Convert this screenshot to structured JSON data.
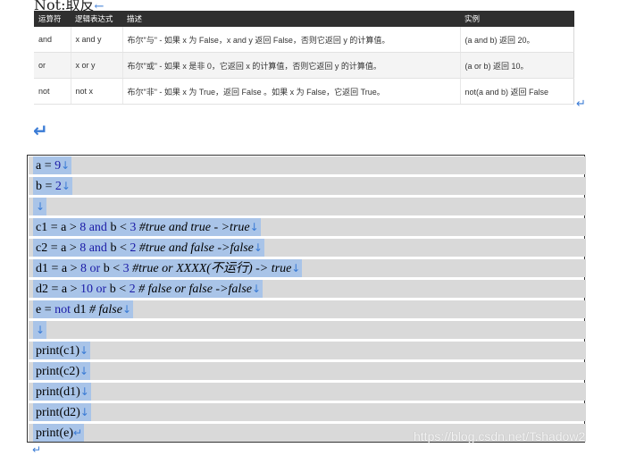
{
  "heading": {
    "text": "Not:取反",
    "arrow": "←"
  },
  "table": {
    "headers": [
      "运算符",
      "逻辑表达式",
      "描述",
      "实例"
    ],
    "rows": [
      [
        "and",
        "x and y",
        "布尔\"与\" - 如果 x 为 False，x and y 返回 False，否则它返回 y 的计算值。",
        "(a and b) 返回 20。"
      ],
      [
        "or",
        "x or y",
        "布尔\"或\" - 如果 x 是非 0，它返回 x 的计算值，否则它返回 y 的计算值。",
        "(a or b) 返回 10。"
      ],
      [
        "not",
        "not x",
        "布尔\"非\" - 如果 x 为 True，返回 False 。如果 x 为 False，它返回 True。",
        "not(a and b) 返回 False"
      ]
    ]
  },
  "marks": {
    "return_arrow": "↵",
    "newline": "↓",
    "end": "↵"
  },
  "code": {
    "l1": {
      "a": "a = ",
      "b": "9"
    },
    "l2": {
      "a": "b = ",
      "b": "2"
    },
    "l4": {
      "a": "c1 = a > ",
      "b": "8",
      "c": " and ",
      "d": " b < ",
      "e": "3",
      "f": " #true and true - >true"
    },
    "l5": {
      "a": "c2 = a > ",
      "b": "8",
      "c": " and ",
      "d": " b < ",
      "e": "2",
      "f": " #true and false ->false"
    },
    "l6": {
      "a": "d1 = a > ",
      "b": "8",
      "c": " or ",
      "d": " b < ",
      "e": "3",
      "f": " #true or XXXX(不运行)    -> true"
    },
    "l7": {
      "a": "d2 = a > ",
      "b": "10",
      "c": " or ",
      "d": " b < ",
      "e": "2",
      "f": " # false or false ->false"
    },
    "l8": {
      "a": "e = ",
      "b": "not",
      "c": " d1",
      "f": "      # false"
    },
    "l10": "print(c1)",
    "l11": "print(c2)",
    "l12": "print(d1)",
    "l13": "print(d2)",
    "l14": "print(e)"
  },
  "watermark": "https://blog.csdn.net/Tshadow2"
}
